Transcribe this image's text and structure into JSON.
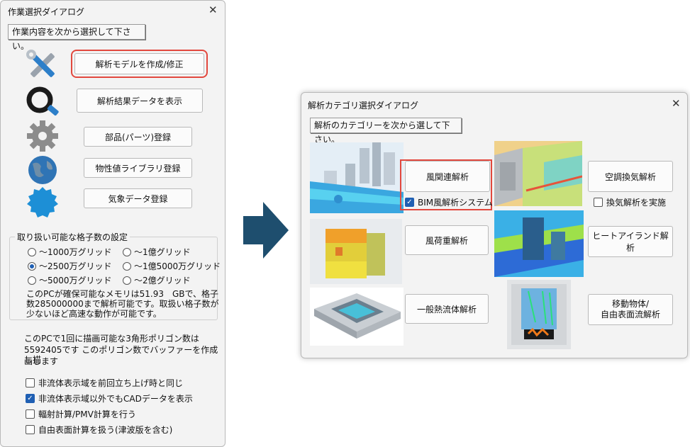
{
  "dialog1": {
    "title": "作業選択ダイアログ",
    "close": "✕",
    "header_button": "作業内容を次から選択して下さい。",
    "buttons": [
      "解析モデルを作成/修正",
      "解析結果データを表示",
      "部品(パーツ)登録",
      "物性値ライブラリ登録",
      "気象データ登録"
    ],
    "icons": [
      "tools-icon",
      "magnifier-icon",
      "gear-icon",
      "globe-icon",
      "seal-icon"
    ],
    "grid_group": {
      "label": "取り扱い可能な格子数の設定",
      "options": [
        "～1000万グリッド",
        "～1億グリッド",
        "～2500万グリッド",
        "～1億5000万グリッド",
        "～5000万グリッド",
        "～2億グリッド"
      ],
      "selected": "～2500万グリッド",
      "memory_note": [
        "このPCが確保可能なメモリは51.93　GBで、格子",
        "数285000000まで解析可能です。取扱い格子数が",
        "少ないほど高速な動作が可能です。"
      ]
    },
    "polygon_note": [
      "このPCで1回に描画可能な3角形ポリゴン数は",
      "5592405です このポリゴン数でバッファーを作成し描",
      "画します"
    ],
    "checkboxes": [
      {
        "label": "非流体表示域を前回立ち上げ時と同じ",
        "checked": false
      },
      {
        "label": "非流体表示域以外でもCADデータを表示",
        "checked": true
      },
      {
        "label": "輻射計算/PMV計算を行う",
        "checked": false
      },
      {
        "label": "自由表面計算を扱う(津波版を含む)",
        "checked": false
      }
    ]
  },
  "arrow_color": "#1e4e6e",
  "accent_red": "#e2483e",
  "dialog2": {
    "title": "解析カテゴリ選択ダイアログ",
    "close": "✕",
    "header_button": "解析のカテゴリーを次から選して下さい。",
    "buttons": {
      "wind": "風関連解析",
      "wind_load": "風荷重解析",
      "thermal": "一般熱流体解析",
      "hvac": "空調換気解析",
      "heat_island": "ヒートアイランド解析",
      "moving_1": "移動物体/",
      "moving_2": "自由表面流解析"
    },
    "bim_check": {
      "label": "BIM風解析システム",
      "checked": true
    },
    "vent_check": {
      "label": "換気解析を実施",
      "checked": false
    }
  }
}
